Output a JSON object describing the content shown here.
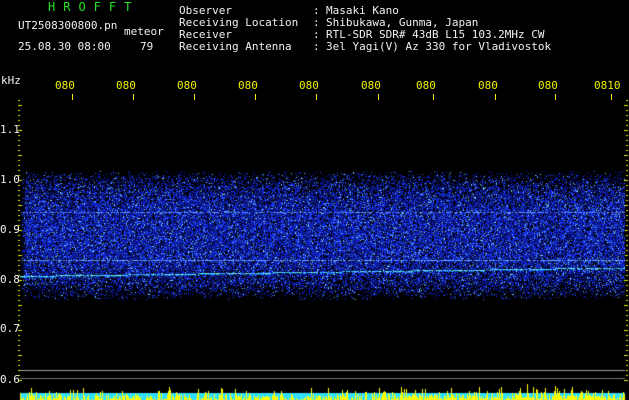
{
  "header": {
    "title": "HROFFT",
    "filename": "UT2508300800.pn",
    "mode_label": "meteor",
    "datetime": "25.08.30 08:00",
    "count": "79"
  },
  "info": [
    {
      "label": "Observer",
      "colon": ":",
      "value": "Masaki Kano"
    },
    {
      "label": "Receiving Location",
      "colon": ":",
      "value": "Shibukawa, Gunma, Japan"
    },
    {
      "label": "Receiver",
      "colon": ":",
      "value": "RTL-SDR SDR# 43dB L15 103.2MHz CW"
    },
    {
      "label": "Receiving Antenna",
      "colon": ":",
      "value": "3el Yagi(V) Az 330 for Vladivostok"
    }
  ],
  "axis": {
    "y_unit": "kHz",
    "y_ticks": [
      "1.1",
      "1.0",
      "0.9",
      "0.8",
      "0.7",
      "0.6"
    ],
    "x_ticks": [
      "080",
      "080",
      "080",
      "080",
      "080",
      "080",
      "080",
      "080",
      "080",
      "0810"
    ]
  },
  "colors": {
    "background": "#000000",
    "header_green": "#22e022",
    "tick_yellow": "#f0f000",
    "text_white": "#f0f0f0",
    "signal_blue": "#1a3cff",
    "signal_cyan": "#40e0ff",
    "level_yellow": "#ffff00"
  }
}
